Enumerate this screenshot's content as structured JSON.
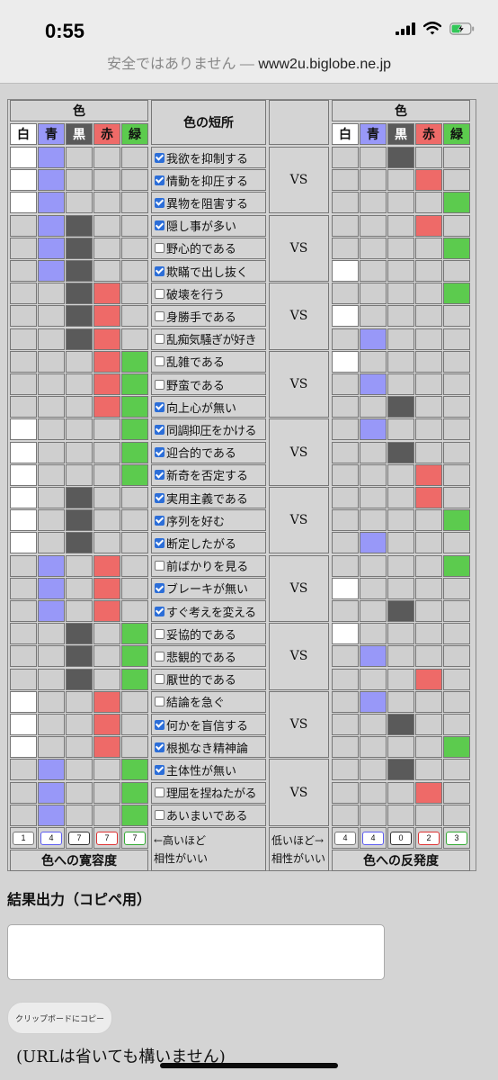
{
  "status_bar": {
    "time": "0:55"
  },
  "browser": {
    "security": "安全ではありません — ",
    "host": "www2u.biglobe.ne.jp"
  },
  "table": {
    "left_header": "色",
    "right_header": "色",
    "middle_header": "色の短所",
    "vs_label": "VS",
    "colors": [
      "白",
      "青",
      "黒",
      "赤",
      "緑"
    ],
    "color_fills": {
      "white": "#ffffff",
      "blue": "#9898f8",
      "black": "#5a5a5a",
      "red": "#ee6a68",
      "green": "#5ccb4e",
      "empty": "#cfcfcf"
    },
    "groups": [
      {
        "left": [
          1,
          1,
          0,
          0,
          0
        ],
        "items": [
          {
            "label": "我欲を抑制する",
            "checked": true,
            "right": [
              0,
              0,
              1,
              0,
              0
            ]
          },
          {
            "label": "情動を抑圧する",
            "checked": true,
            "right": [
              0,
              0,
              0,
              1,
              0
            ]
          },
          {
            "label": "異物を阻害する",
            "checked": true,
            "right": [
              0,
              0,
              0,
              0,
              1
            ]
          }
        ]
      },
      {
        "left": [
          0,
          1,
          1,
          0,
          0
        ],
        "items": [
          {
            "label": "隠し事が多い",
            "checked": true,
            "right": [
              0,
              0,
              0,
              1,
              0
            ]
          },
          {
            "label": "野心的である",
            "checked": false,
            "right": [
              0,
              0,
              0,
              0,
              1
            ]
          },
          {
            "label": "欺瞞で出し抜く",
            "checked": true,
            "right": [
              1,
              0,
              0,
              0,
              0
            ]
          }
        ]
      },
      {
        "left": [
          0,
          0,
          1,
          1,
          0
        ],
        "items": [
          {
            "label": "破壊を行う",
            "checked": false,
            "right": [
              0,
              0,
              0,
              0,
              1
            ]
          },
          {
            "label": "身勝手である",
            "checked": false,
            "right": [
              1,
              0,
              0,
              0,
              0
            ]
          },
          {
            "label": "乱痴気騒ぎが好き",
            "checked": false,
            "right": [
              0,
              1,
              0,
              0,
              0
            ]
          }
        ]
      },
      {
        "left": [
          0,
          0,
          0,
          1,
          1
        ],
        "items": [
          {
            "label": "乱雑である",
            "checked": false,
            "right": [
              1,
              0,
              0,
              0,
              0
            ]
          },
          {
            "label": "野蛮である",
            "checked": false,
            "right": [
              0,
              1,
              0,
              0,
              0
            ]
          },
          {
            "label": "向上心が無い",
            "checked": true,
            "right": [
              0,
              0,
              1,
              0,
              0
            ]
          }
        ]
      },
      {
        "left": [
          1,
          0,
          0,
          0,
          1
        ],
        "items": [
          {
            "label": "同調抑圧をかける",
            "checked": true,
            "right": [
              0,
              1,
              0,
              0,
              0
            ]
          },
          {
            "label": "迎合的である",
            "checked": true,
            "right": [
              0,
              0,
              1,
              0,
              0
            ]
          },
          {
            "label": "新奇を否定する",
            "checked": true,
            "right": [
              0,
              0,
              0,
              1,
              0
            ]
          }
        ]
      },
      {
        "left": [
          1,
          0,
          1,
          0,
          0
        ],
        "items": [
          {
            "label": "実用主義である",
            "checked": true,
            "right": [
              0,
              0,
              0,
              1,
              0
            ]
          },
          {
            "label": "序列を好む",
            "checked": true,
            "right": [
              0,
              0,
              0,
              0,
              1
            ]
          },
          {
            "label": "断定したがる",
            "checked": true,
            "right": [
              0,
              1,
              0,
              0,
              0
            ]
          }
        ]
      },
      {
        "left": [
          0,
          1,
          0,
          1,
          0
        ],
        "items": [
          {
            "label": "前ばかりを見る",
            "checked": false,
            "right": [
              0,
              0,
              0,
              0,
              1
            ]
          },
          {
            "label": "ブレーキが無い",
            "checked": true,
            "right": [
              1,
              0,
              0,
              0,
              0
            ]
          },
          {
            "label": "すぐ考えを変える",
            "checked": true,
            "right": [
              0,
              0,
              1,
              0,
              0
            ]
          }
        ]
      },
      {
        "left": [
          0,
          0,
          1,
          0,
          1
        ],
        "items": [
          {
            "label": "妥協的である",
            "checked": false,
            "right": [
              1,
              0,
              0,
              0,
              0
            ]
          },
          {
            "label": "悲観的である",
            "checked": false,
            "right": [
              0,
              1,
              0,
              0,
              0
            ]
          },
          {
            "label": "厭世的である",
            "checked": false,
            "right": [
              0,
              0,
              0,
              1,
              0
            ]
          }
        ]
      },
      {
        "left": [
          1,
          0,
          0,
          1,
          0
        ],
        "items": [
          {
            "label": "結論を急ぐ",
            "checked": false,
            "right": [
              0,
              1,
              0,
              0,
              0
            ]
          },
          {
            "label": "何かを盲信する",
            "checked": true,
            "right": [
              0,
              0,
              1,
              0,
              0
            ]
          },
          {
            "label": "根拠なき精神論",
            "checked": true,
            "right": [
              0,
              0,
              0,
              0,
              1
            ]
          }
        ]
      },
      {
        "left": [
          0,
          1,
          0,
          0,
          1
        ],
        "items": [
          {
            "label": "主体性が無い",
            "checked": true,
            "right": [
              0,
              0,
              1,
              0,
              0
            ]
          },
          {
            "label": "理屈を捏ねたがる",
            "checked": false,
            "right": [
              0,
              0,
              0,
              1,
              0
            ]
          },
          {
            "label": "あいまいである",
            "checked": false,
            "right": [
              0,
              0,
              0,
              0,
              0
            ]
          }
        ]
      }
    ],
    "left_counts": [
      "1",
      "4",
      "7",
      "7",
      "7"
    ],
    "right_counts": [
      "4",
      "4",
      "0",
      "2",
      "3"
    ],
    "left_note": [
      "←高いほど",
      "相性がいい"
    ],
    "right_note": [
      "低いほど→",
      "相性がいい"
    ],
    "left_footer": "色への寛容度",
    "right_footer": "色への反発度"
  },
  "result": {
    "title": "結果出力（コピペ用）",
    "value": "",
    "copy_button": "クリップボードにコピー"
  },
  "footer_note": "(URLは省いても構いません)"
}
